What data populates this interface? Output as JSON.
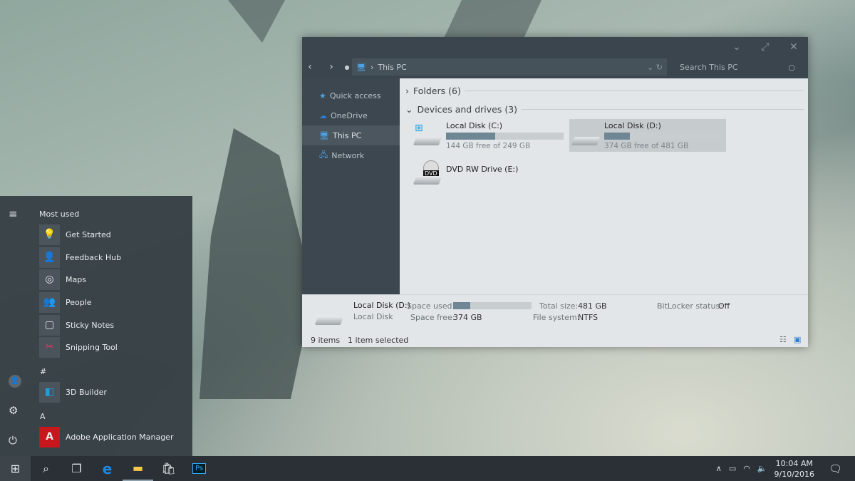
{
  "explorer": {
    "window_controls": [
      "minimize",
      "maximize",
      "close"
    ],
    "address": {
      "path": "This PC",
      "icon": "computer-icon"
    },
    "search": {
      "placeholder": "Search This PC"
    },
    "nav": [
      {
        "label": "Quick access",
        "icon": "star-icon"
      },
      {
        "label": "OneDrive",
        "icon": "cloud-icon"
      },
      {
        "label": "This PC",
        "icon": "computer-icon",
        "selected": true
      },
      {
        "label": "Network",
        "icon": "network-icon"
      }
    ],
    "groups": {
      "folders": "Folders (6)",
      "devices": "Devices and drives (3)"
    },
    "drives": [
      {
        "name": "Local Disk (C:)",
        "free": "144 GB free of 249 GB",
        "used_fraction": 0.42
      },
      {
        "name": "Local Disk (D:)",
        "free": "374 GB free of 481 GB",
        "used_fraction": 0.22,
        "selected": true
      },
      {
        "name": "DVD RW Drive (E:)",
        "badge": "DVD"
      }
    ],
    "details": {
      "name": "Local Disk (D:)",
      "type": "Local Disk",
      "space_used_label": "Space used:",
      "space_used_fraction": 0.22,
      "space_free_label": "Space free:",
      "space_free": "374 GB",
      "total_label": "Total size:",
      "total": "481 GB",
      "fs_label": "File system:",
      "fs": "NTFS",
      "bitlocker_label": "BitLocker status:",
      "bitlocker": "Off"
    },
    "status": {
      "items": "9 items",
      "selected": "1 item selected"
    }
  },
  "start": {
    "most_used": "Most used",
    "apps": [
      {
        "label": "Get Started"
      },
      {
        "label": "Feedback Hub"
      },
      {
        "label": "Maps"
      },
      {
        "label": "People"
      },
      {
        "label": "Sticky Notes"
      },
      {
        "label": "Snipping Tool"
      }
    ],
    "sections": [
      {
        "letter": "#",
        "apps": [
          {
            "label": "3D Builder"
          }
        ]
      },
      {
        "letter": "A",
        "apps": [
          {
            "label": "Adobe Application Manager"
          }
        ]
      }
    ]
  },
  "taskbar": {
    "time": "10:04 AM",
    "date": "9/10/2016",
    "ps_label": "Ps"
  }
}
